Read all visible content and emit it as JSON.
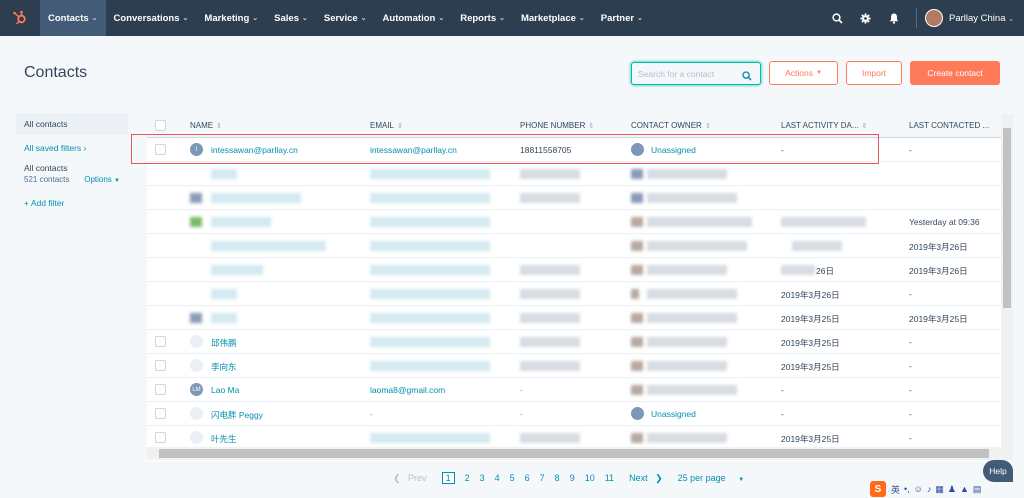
{
  "topnav": {
    "items": [
      {
        "label": "Contacts",
        "active": true
      },
      {
        "label": "Conversations"
      },
      {
        "label": "Marketing"
      },
      {
        "label": "Sales"
      },
      {
        "label": "Service"
      },
      {
        "label": "Automation"
      },
      {
        "label": "Reports"
      },
      {
        "label": "Marketplace"
      },
      {
        "label": "Partner"
      }
    ],
    "user_name": "Parllay China",
    "icons": [
      "search-icon",
      "gear-icon",
      "bell-icon"
    ]
  },
  "page": {
    "title": "Contacts",
    "search_placeholder": "Search for a contact",
    "actions_label": "Actions",
    "import_label": "Import",
    "create_label": "Create contact"
  },
  "sidebar": {
    "active_label": "All contacts",
    "saved_filters": "All saved filters",
    "view_name": "All contacts",
    "count": "521 contacts",
    "options": "Options",
    "add_filter": "Add filter"
  },
  "table": {
    "headers": [
      "NAME",
      "EMAIL",
      "PHONE NUMBER",
      "CONTACT OWNER",
      "LAST ACTIVITY DA...",
      "LAST CONTACTED ..."
    ],
    "rows": [
      {
        "avatar": "I",
        "name": "intessawan@parllay.cn",
        "email": "intessawan@parllay.cn",
        "phone": "18811558705",
        "owner": "Unassigned",
        "activity": "-",
        "contacted": "-"
      },
      {
        "avatar": "",
        "name": "",
        "email": "",
        "phone": "",
        "owner": "",
        "activity": "",
        "contacted": ""
      },
      {
        "avatar": "",
        "name": "",
        "email": "",
        "phone": "",
        "owner": "",
        "activity": "",
        "contacted": ""
      },
      {
        "avatar": "",
        "name": "",
        "email": "",
        "phone": "",
        "owner": "",
        "activity": "",
        "contacted": "Yesterday at 09:36"
      },
      {
        "avatar": "",
        "name": "",
        "email": "",
        "phone": "",
        "owner": "",
        "activity": "",
        "contacted": "2019年3月26日"
      },
      {
        "avatar": "",
        "name": "",
        "email": "",
        "phone": "",
        "owner": "",
        "activity": "26日",
        "contacted": "2019年3月26日"
      },
      {
        "avatar": "",
        "name": "",
        "email": "",
        "phone": "",
        "owner": "",
        "activity": "2019年3月26日",
        "contacted": "-"
      },
      {
        "avatar": "",
        "name": "",
        "email": "",
        "phone": "",
        "owner": "",
        "activity": "2019年3月25日",
        "contacted": "2019年3月25日"
      },
      {
        "avatar": "",
        "name": "邱伟鹏",
        "email": "",
        "phone": "",
        "owner": "",
        "activity": "2019年3月25日",
        "contacted": "-"
      },
      {
        "avatar": "",
        "name": "李向东",
        "email": "",
        "phone": "",
        "owner": "",
        "activity": "2019年3月25日",
        "contacted": "-"
      },
      {
        "avatar": "LM",
        "name": "Lao Ma",
        "email": "laoma8@gmail.com",
        "phone": "-",
        "owner": "",
        "activity": "-",
        "contacted": "-"
      },
      {
        "avatar": "",
        "name": "闪电胖 Peggy",
        "email": "-",
        "phone": "-",
        "owner": "Unassigned",
        "activity": "-",
        "contacted": "-"
      },
      {
        "avatar": "",
        "name": "叶先生",
        "email": "",
        "phone": "",
        "owner": "",
        "activity": "2019年3月25日",
        "contacted": "-"
      }
    ]
  },
  "pager": {
    "prev": "Prev",
    "pages": [
      "1",
      "2",
      "3",
      "4",
      "5",
      "6",
      "7",
      "8",
      "9",
      "10",
      "11"
    ],
    "current": "1",
    "next": "Next",
    "per_page": "25 per page"
  },
  "help_label": "Help",
  "ime": {
    "logo": "S",
    "lang": "英"
  }
}
